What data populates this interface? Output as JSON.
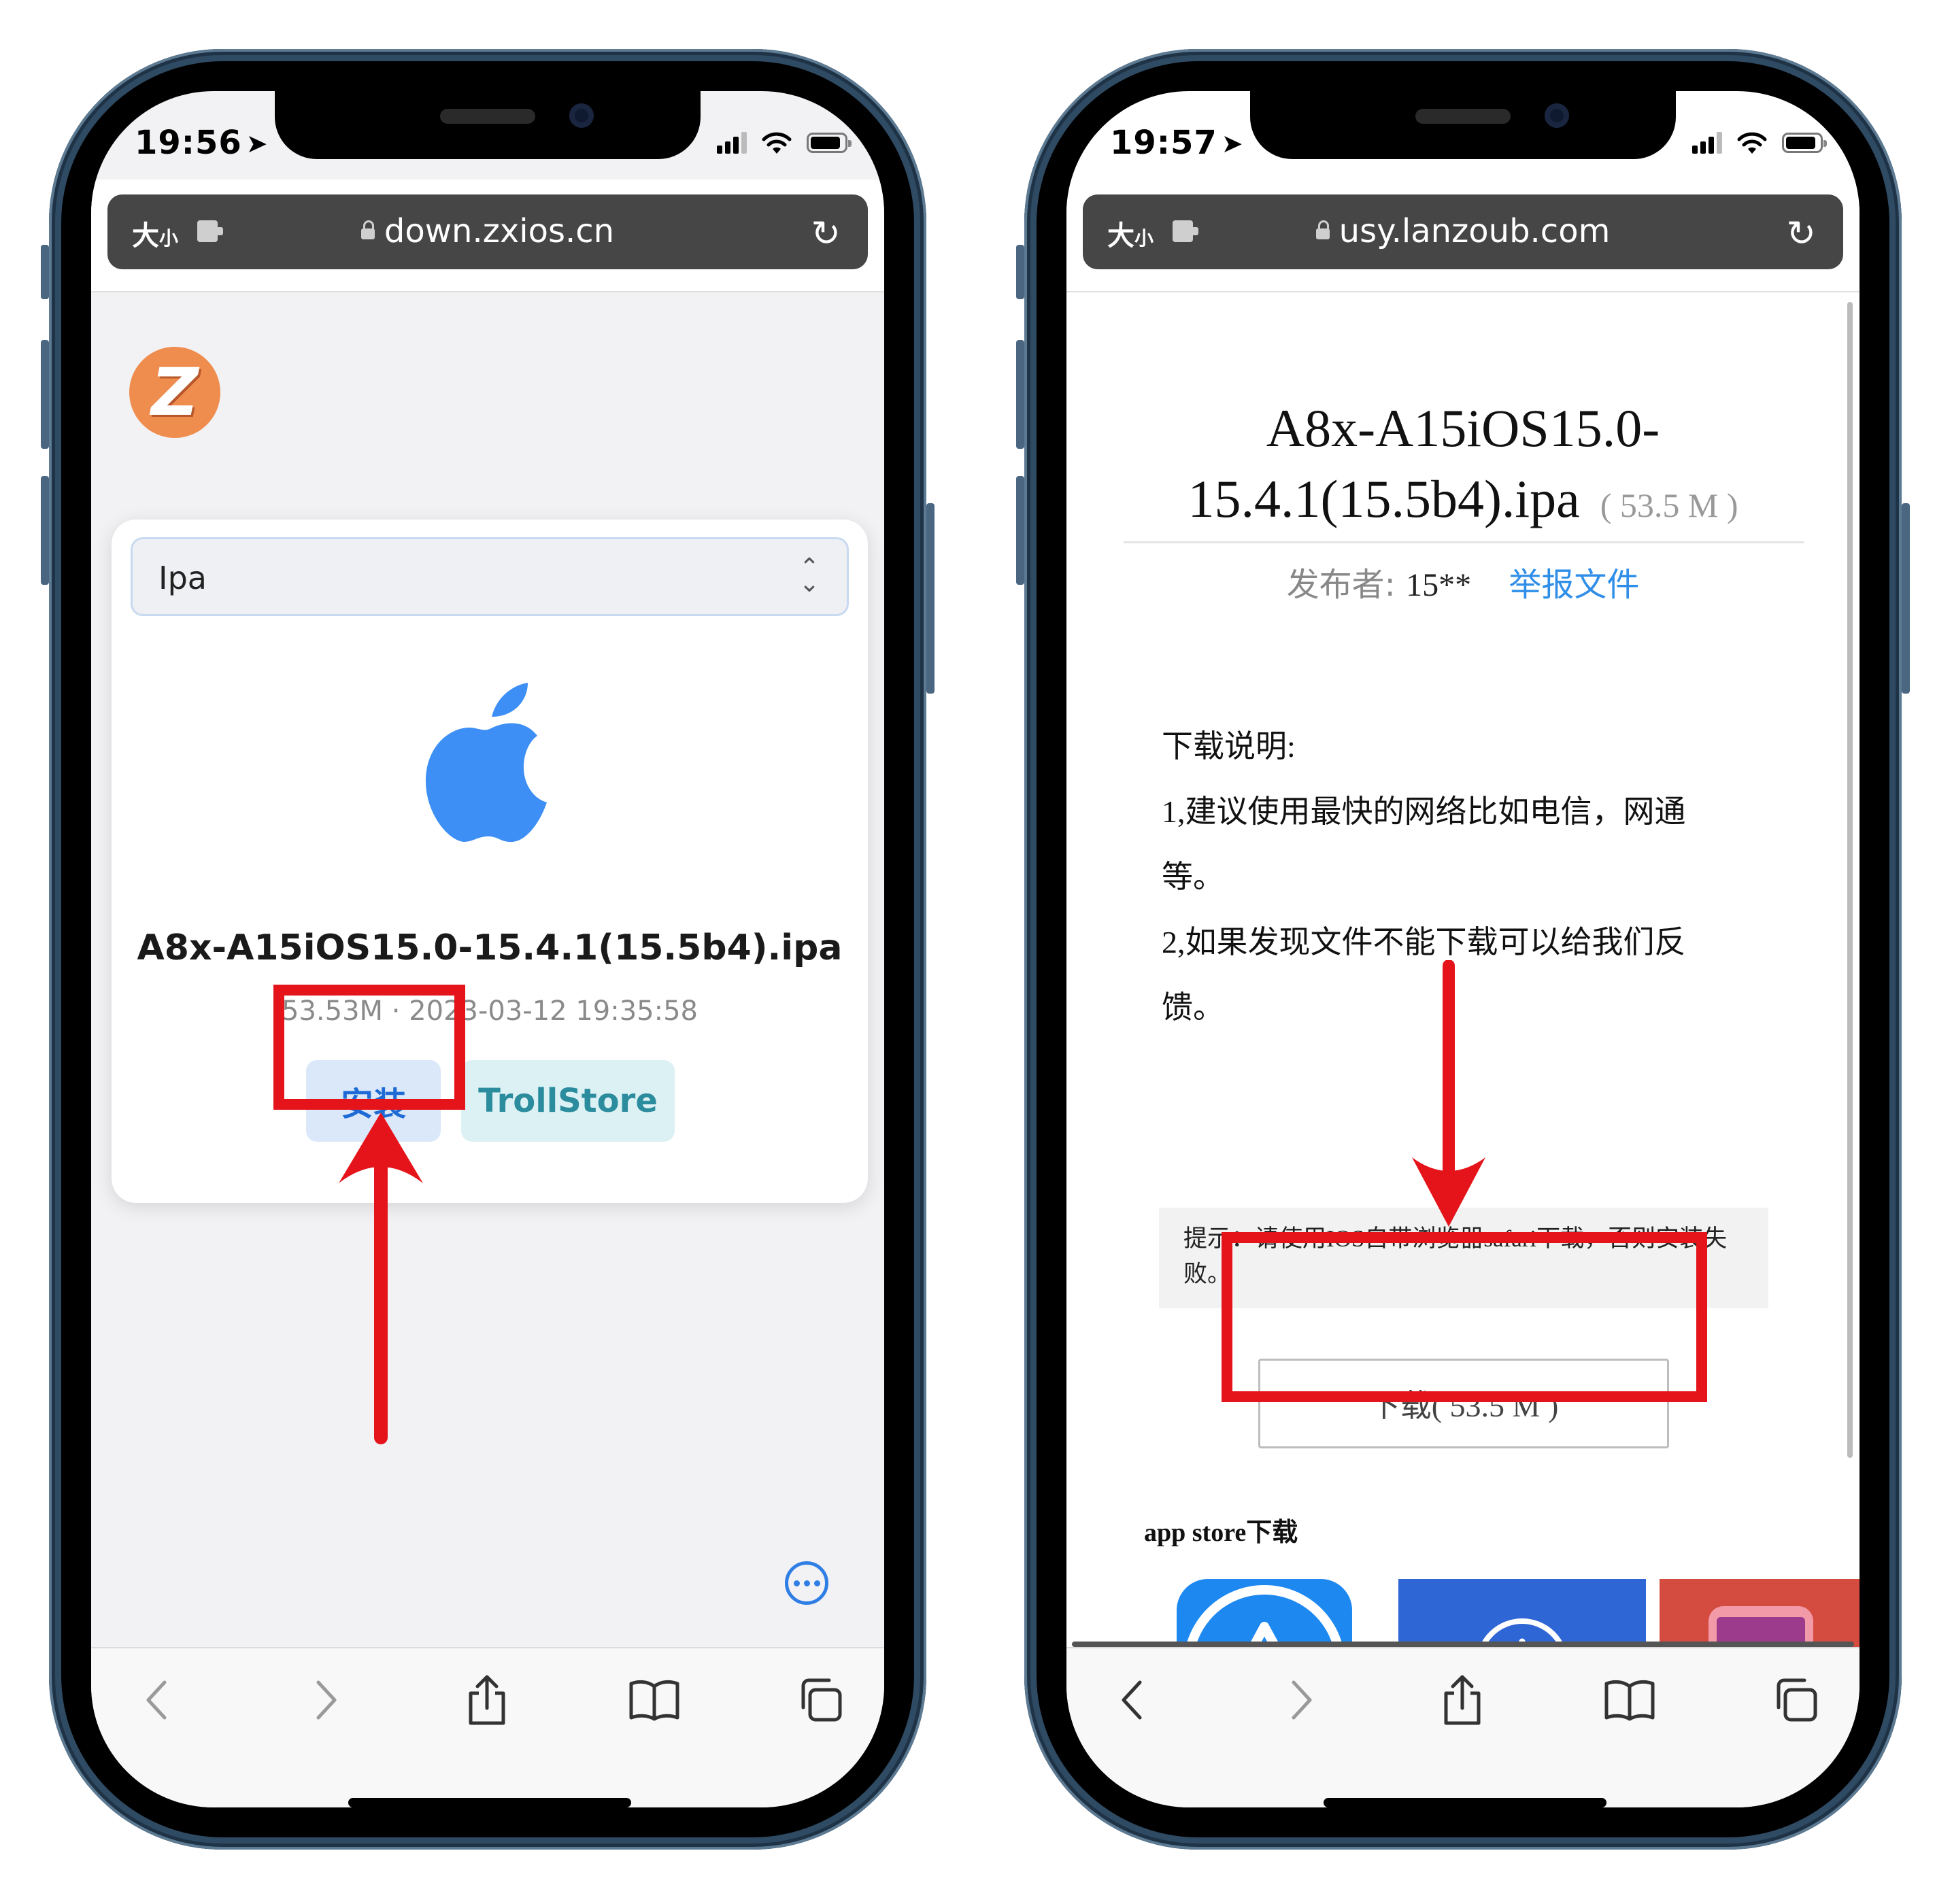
{
  "colors": {
    "frame": "#2f4a63",
    "highlight_red": "#e5141b",
    "install_text": "#1e6bd6",
    "install_bg": "#dbe8fa",
    "trollstore_text": "#2b8c9e",
    "trollstore_bg": "#dcf1f4",
    "apple_logo": "#3d8ff5",
    "report_link": "#2f8ee8"
  },
  "left_phone": {
    "time": "19:56",
    "text_size_label": "大",
    "text_size_small": "小",
    "url": "down.zxios.cn",
    "logo_letter": "Z",
    "select_value": "Ipa",
    "app_icon": "apple-logo-icon",
    "file_name": "A8x-A15iOS15.0-15.4.1(15.5b4).ipa",
    "file_meta": "53.53M · 2023-03-12 19:35:58",
    "install_label": "安装",
    "trollstore_label": "TrollStore"
  },
  "right_phone": {
    "time": "19:57",
    "text_size_label": "大",
    "text_size_small": "小",
    "url": "usy.lanzoub.com",
    "title_line1": "A8x-A15iOS15.0-",
    "title_line2": "15.4.1(15.5b4).ipa",
    "file_size": "( 53.5 M )",
    "publisher_label": "发布者:",
    "publisher_value": "15**",
    "report_label": "举报文件",
    "desc_heading": "下载说明:",
    "desc_line1": "1,建议使用最快的网络比如电信，网通",
    "desc_line2": "等。",
    "desc_line3": "2,如果发现文件不能下载可以给我们反",
    "desc_line4": "馈。",
    "tip_text": "提示：请使用IOS自带浏览器safari下载，否则安装失败。",
    "download_label": "下载( 53.5 M )",
    "appstore_heading": "app store下载"
  }
}
